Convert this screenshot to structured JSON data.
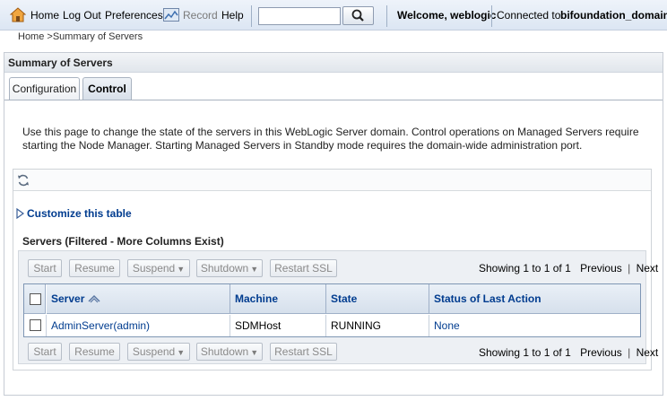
{
  "toolbar": {
    "home": "Home",
    "logout": "Log Out",
    "preferences": "Preferences",
    "record": "Record",
    "help": "Help",
    "search_value": "",
    "welcome": "Welcome, weblogic",
    "connected_label": "Connected to:",
    "domain": "bifoundation_domain"
  },
  "breadcrumb": "Home >Summary of Servers",
  "panel": {
    "title": "Summary of Servers",
    "tabs": [
      {
        "label": "Configuration",
        "active": false
      },
      {
        "label": "Control",
        "active": true
      }
    ],
    "description": "Use this page to change the state of the servers in this WebLogic Server domain. Control operations on Managed Servers require starting the Node Manager. Starting Managed Servers in Standby mode requires the domain-wide administration port."
  },
  "table": {
    "customize_label": "Customize this table",
    "title": "Servers (Filtered - More Columns Exist)",
    "buttons": {
      "start": "Start",
      "resume": "Resume",
      "suspend": "Suspend",
      "shutdown": "Shutdown",
      "restart_ssl": "Restart SSL"
    },
    "pager": {
      "showing": "Showing 1 to 1 of 1",
      "previous": "Previous",
      "separator": "|",
      "next": "Next"
    },
    "columns": [
      "Server",
      "Machine",
      "State",
      "Status of Last Action"
    ],
    "rows": [
      {
        "server": "AdminServer(admin)",
        "machine": "SDMHost",
        "state": "RUNNING",
        "status": "None"
      }
    ]
  },
  "colors": {
    "link": "#003c8f",
    "toolbar_bg": "#dce6f3",
    "header_text": "#003c8f"
  }
}
